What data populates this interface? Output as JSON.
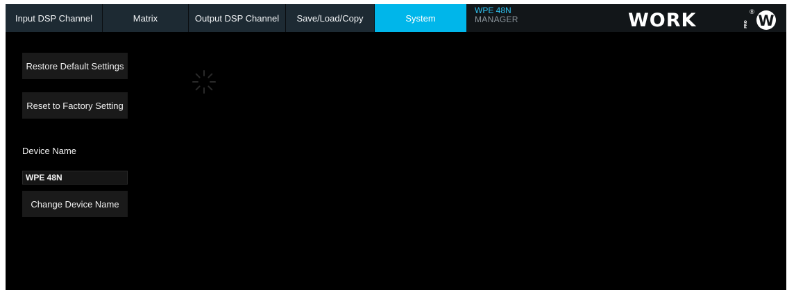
{
  "tabs": [
    {
      "label": "Input DSP Channel",
      "active": false
    },
    {
      "label": "Matrix",
      "active": false
    },
    {
      "label": "Output DSP Channel",
      "active": false
    },
    {
      "label": "Save/Load/Copy",
      "active": false
    },
    {
      "label": "System",
      "active": true
    }
  ],
  "brand": {
    "model": "WPE 48N",
    "subtitle": "MANAGER",
    "logo_text": "WORK",
    "logo_side_text": "PRO",
    "logo_mark": "®",
    "logo_badge": "W"
  },
  "system": {
    "restore_label": "Restore Default Settings",
    "reset_label": "Reset to Factory Setting",
    "device_name_label": "Device Name",
    "device_name_value": "WPE 48N",
    "change_name_label": "Change Device Name"
  },
  "icons": {
    "loading": "loading-spinner-icon"
  },
  "colors": {
    "tab_bg": "#1d2a33",
    "tab_active": "#00b6ea",
    "brand_model": "#2ec2f0",
    "background": "#000000"
  }
}
